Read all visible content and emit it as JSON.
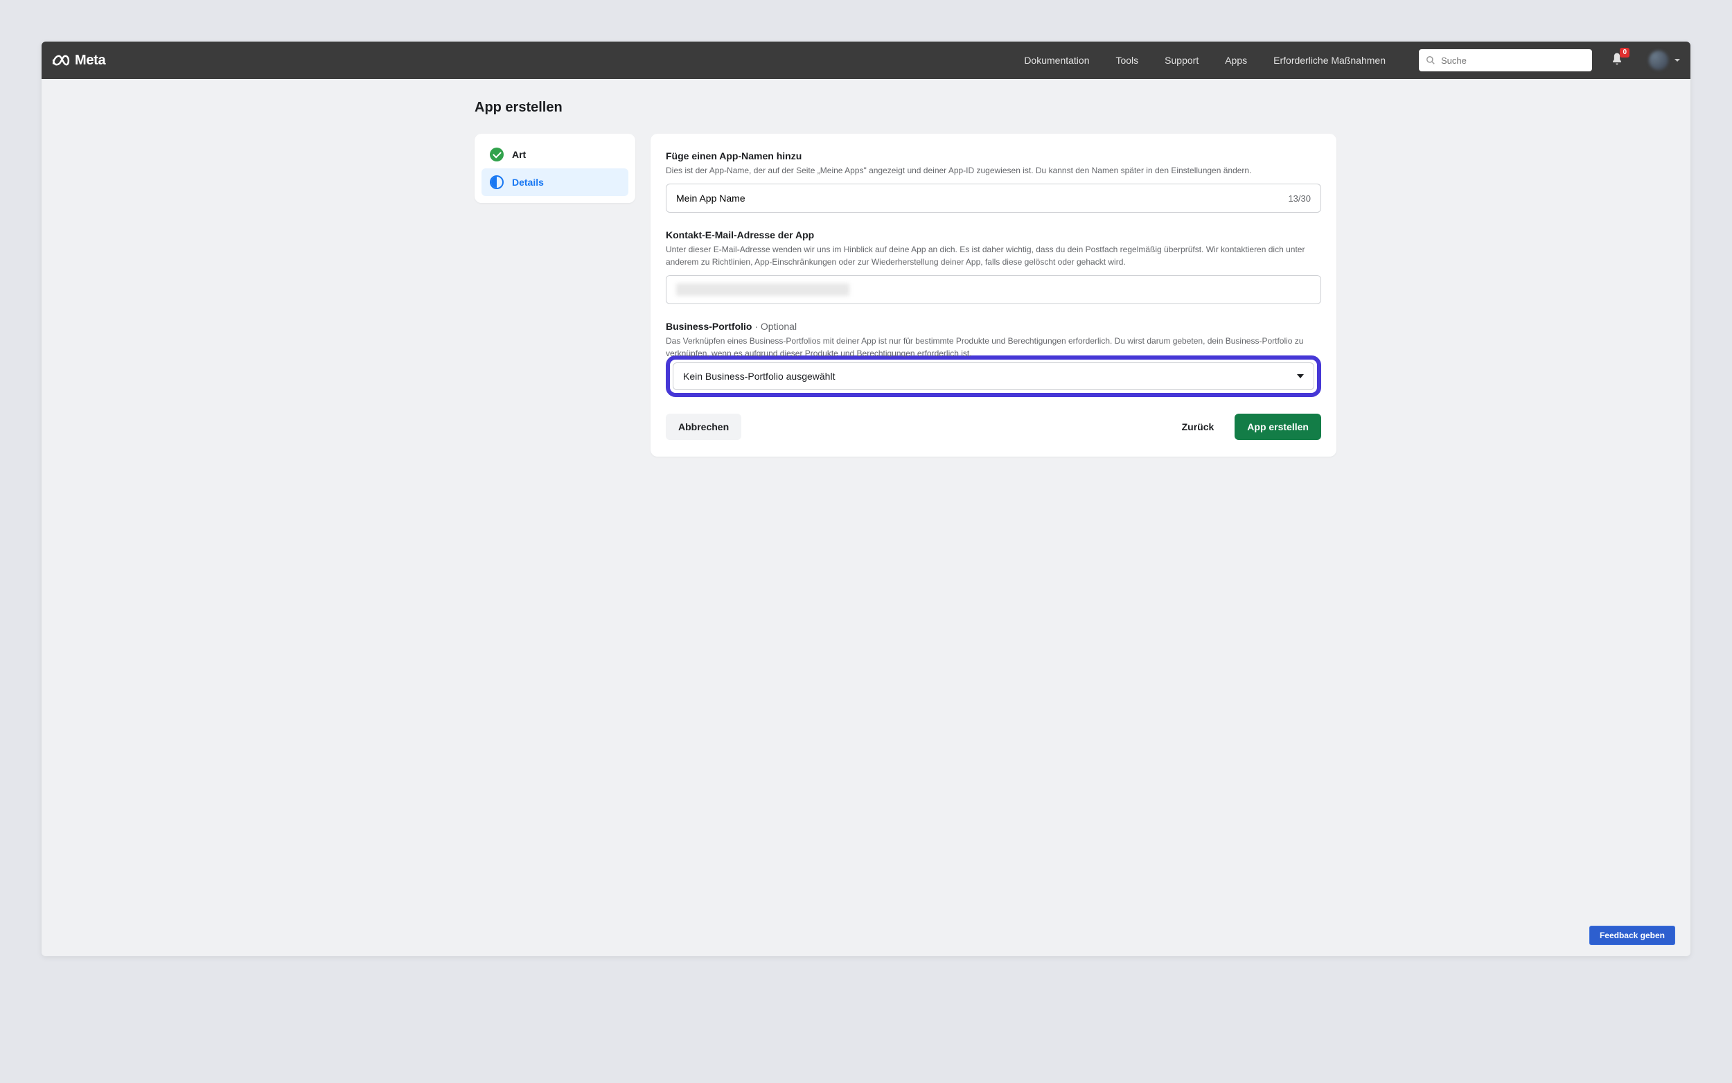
{
  "brand": {
    "name": "Meta"
  },
  "nav": {
    "documentation": "Dokumentation",
    "tools": "Tools",
    "support": "Support",
    "apps": "Apps",
    "requiredActions": "Erforderliche Maßnahmen"
  },
  "search": {
    "placeholder": "Suche"
  },
  "notifications": {
    "badge": "0"
  },
  "page": {
    "title": "App erstellen"
  },
  "sidebar": {
    "items": [
      {
        "label": "Art",
        "state": "completed"
      },
      {
        "label": "Details",
        "state": "active"
      }
    ]
  },
  "form": {
    "appName": {
      "title": "Füge einen App-Namen hinzu",
      "desc": "Dies ist der App-Name, der auf der Seite „Meine Apps\" angezeigt und deiner App-ID zugewiesen ist. Du kannst den Namen später in den Einstellungen ändern.",
      "value": "Mein App Name",
      "count": "13/30"
    },
    "contactEmail": {
      "title": "Kontakt-E-Mail-Adresse der App",
      "desc": "Unter dieser E-Mail-Adresse wenden wir uns im Hinblick auf deine App an dich. Es ist daher wichtig, dass du dein Postfach regelmäßig überprüfst. Wir kontaktieren dich unter anderem zu Richtlinien, App-Einschränkungen oder zur Wiederherstellung deiner App, falls diese gelöscht oder gehackt wird."
    },
    "businessPortfolio": {
      "title": "Business-Portfolio",
      "optional": " · Optional",
      "desc": "Das Verknüpfen eines Business-Portfolios mit deiner App ist nur für bestimmte Produkte und Berechtigungen erforderlich. Du wirst darum gebeten, dein Business-Portfolio zu verknüpfen, wenn es aufgrund dieser Produkte und Berechtigungen erforderlich ist.",
      "selected": "Kein Business-Portfolio ausgewählt"
    }
  },
  "actions": {
    "cancel": "Abbrechen",
    "back": "Zurück",
    "create": "App erstellen"
  },
  "feedback": {
    "label": "Feedback geben"
  }
}
